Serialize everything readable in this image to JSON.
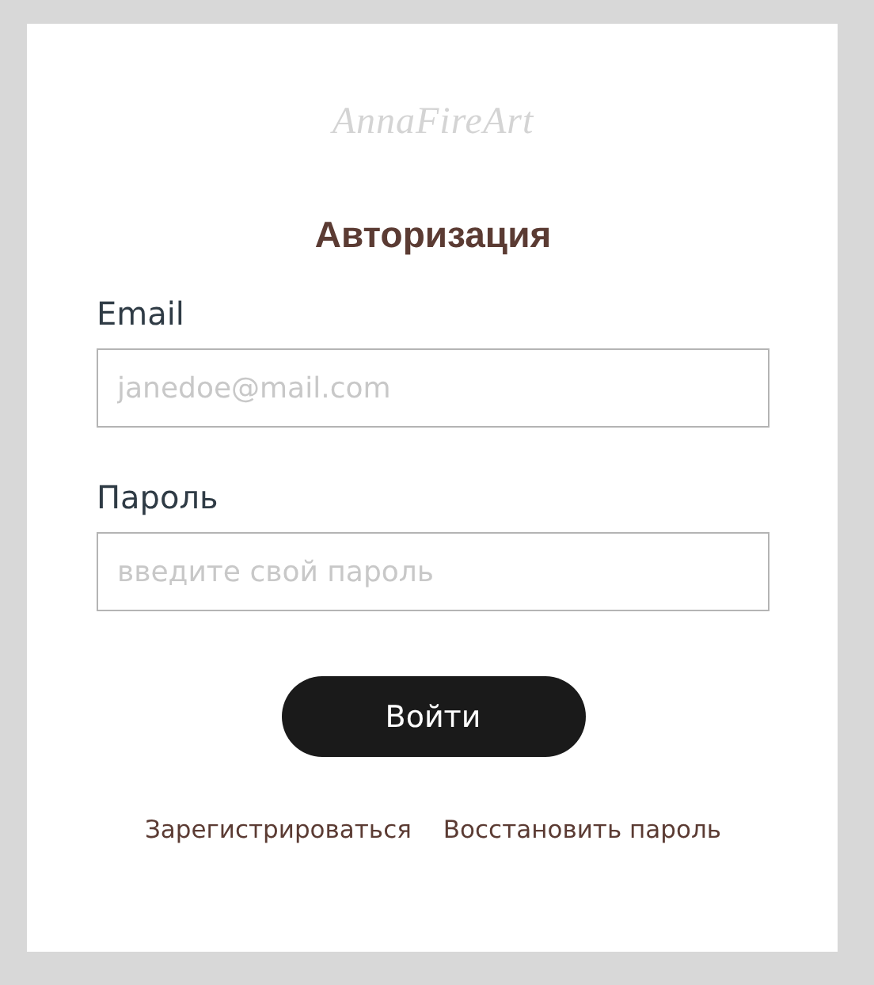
{
  "logo": "AnnaFireArt",
  "title": "Авторизация",
  "fields": [
    {
      "label": "Email",
      "placeholder": "janedoe@mail.com"
    },
    {
      "label": "Пароль",
      "placeholder": "введите свой пароль"
    }
  ],
  "submit": "Войти",
  "links": [
    "Зарегистрироваться",
    "Восстановить пароль"
  ]
}
